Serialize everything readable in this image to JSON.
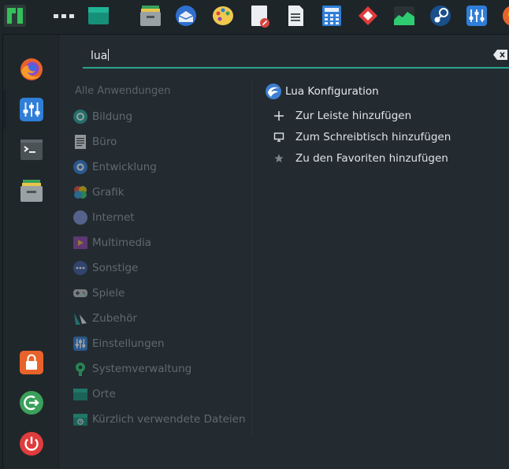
{
  "search": {
    "value": "lua"
  },
  "categories": {
    "header": "Alle Anwendungen",
    "items": [
      {
        "label": "Bildung",
        "icon": "education-icon"
      },
      {
        "label": "Büro",
        "icon": "office-icon"
      },
      {
        "label": "Entwicklung",
        "icon": "development-icon"
      },
      {
        "label": "Grafik",
        "icon": "graphics-icon"
      },
      {
        "label": "Internet",
        "icon": "internet-icon"
      },
      {
        "label": "Multimedia",
        "icon": "multimedia-icon"
      },
      {
        "label": "Sonstige",
        "icon": "other-icon"
      },
      {
        "label": "Spiele",
        "icon": "games-icon"
      },
      {
        "label": "Zubehör",
        "icon": "accessories-icon"
      },
      {
        "label": "Einstellungen",
        "icon": "settings-icon"
      },
      {
        "label": "Systemverwaltung",
        "icon": "system-icon"
      },
      {
        "label": "Orte",
        "icon": "places-icon"
      },
      {
        "label": "Kürzlich verwendete Dateien",
        "icon": "recent-files-icon"
      }
    ]
  },
  "result": {
    "label": "Lua Konfiguration",
    "actions": [
      {
        "label": "Zur Leiste hinzufügen",
        "icon": "plus-icon"
      },
      {
        "label": "Zum Schreibtisch hinzufügen",
        "icon": "monitor-icon"
      },
      {
        "label": "Zu den Favoriten hinzufügen",
        "icon": "star-icon"
      }
    ]
  },
  "colors": {
    "accent": "#2ba38d",
    "background": "#1d2529",
    "text": "#e4e8ea",
    "muted_text": "#5f6a70"
  }
}
